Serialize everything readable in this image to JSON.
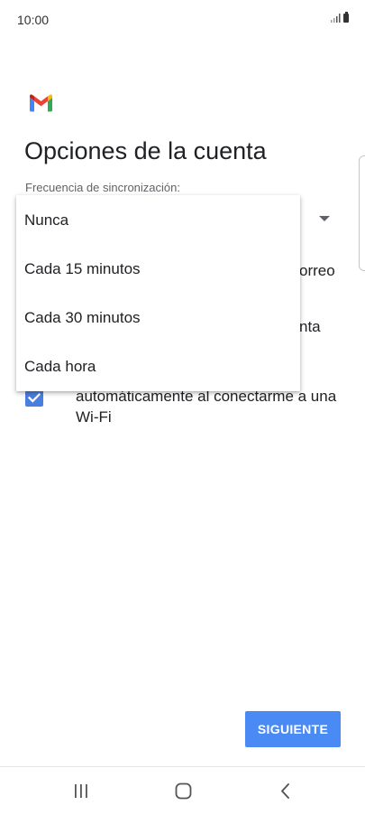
{
  "status_bar": {
    "time": "10:00",
    "icons": [
      "signal-icon",
      "battery-icon"
    ]
  },
  "header": {
    "logo": "gmail-logo-icon",
    "title": "Opciones de la cuenta"
  },
  "sync_frequency": {
    "label": "Frecuencia de sincronización:",
    "options": [
      {
        "label": "Nunca"
      },
      {
        "label": "Cada 15 minutos"
      },
      {
        "label": "Cada 30 minutos"
      },
      {
        "label": "Cada hora"
      }
    ]
  },
  "obscured_fragments": {
    "fragment_1": "orreo",
    "fragment_2": "nta"
  },
  "wifi_attachments": {
    "checked": true,
    "label": "automáticamente al conectarme a una Wi-Fi"
  },
  "footer": {
    "next_label": "SIGUIENTE"
  },
  "colors": {
    "accent": "#4a8af4",
    "checkbox": "#4a7fe0"
  },
  "nav_bar": {
    "icons": [
      "recent-apps-icon",
      "home-icon",
      "back-icon"
    ]
  }
}
